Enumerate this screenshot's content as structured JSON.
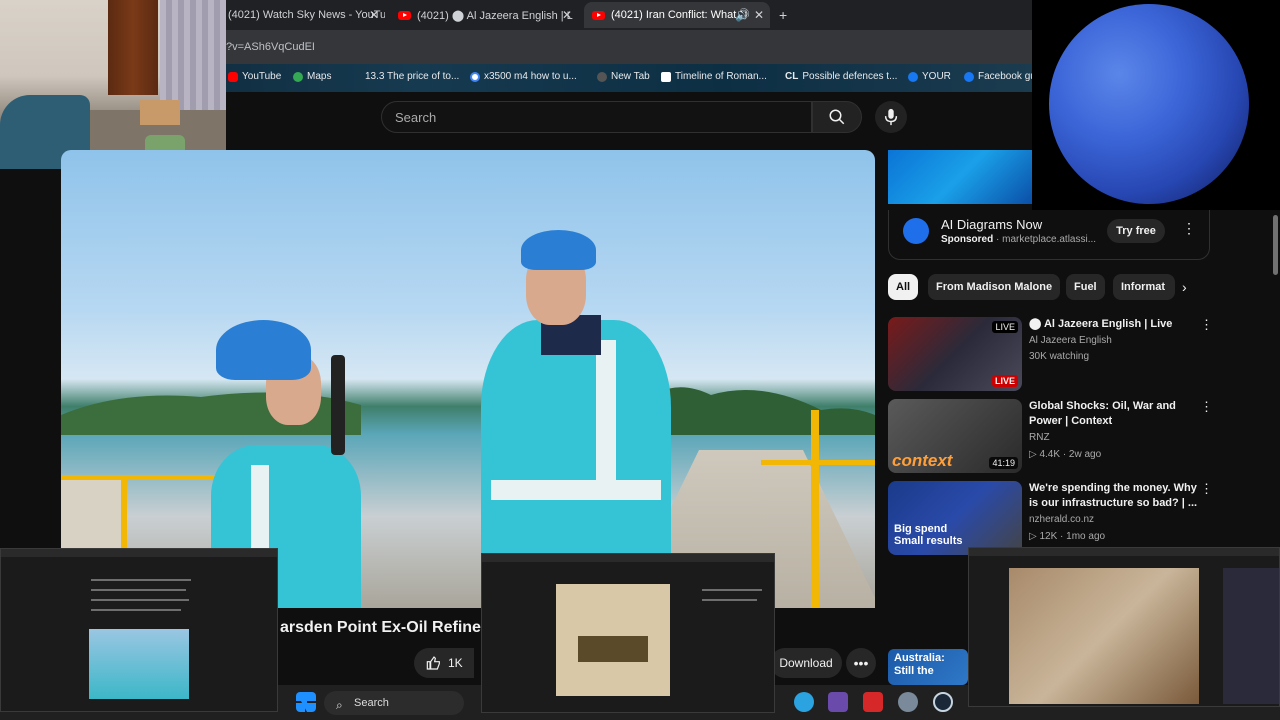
{
  "browser": {
    "tabs": [
      {
        "label": "(4021) Watch Sky News - YouTu",
        "active": false
      },
      {
        "label": "(4021) ⬤ Al Jazeera English | L",
        "active": false
      },
      {
        "label": "(4021) Iran Conflict: What N",
        "active": true
      }
    ],
    "address": "?v=ASh6VqCudEI",
    "bookmarks": [
      "YouTube",
      "Maps",
      "13.3 The price of to...",
      "x3500 m4 how to u...",
      "New Tab",
      "Timeline of Roman...",
      "Possible defences t...",
      "YOUR",
      "Facebook gu"
    ]
  },
  "youtube": {
    "search_placeholder": "Search",
    "video": {
      "title": "arsden Point Ex-Oil Refinery",
      "likes": "1K",
      "download_label": "Download"
    },
    "ad": {
      "title": "AI Diagrams Now",
      "sponsored": "Sponsored",
      "domain": "· marketplace.atlassi...",
      "cta": "Try free"
    },
    "chips": [
      "All",
      "From Madison Malone",
      "Fuel",
      "Informat"
    ],
    "recommendations": [
      {
        "title": "⬤ Al Jazeera English | Live",
        "channel": "Al Jazeera English",
        "meta": "30K watching",
        "badge": "LIVE",
        "verified": true
      },
      {
        "title": "Global Shocks: Oil, War and Power | Context",
        "channel": "RNZ",
        "meta": "▷ 4.4K · 2w ago",
        "badge": "41:19",
        "verified": false,
        "thumb_text": "context"
      },
      {
        "title": "We're spending the money. Why is our infrastructure so bad? | ...",
        "channel": "nzherald.co.nz",
        "meta": "▷ 12K · 1mo ago",
        "badge": "",
        "verified": true,
        "thumb_text": "Big spend Small results"
      },
      {
        "title": "",
        "channel": "",
        "meta": "",
        "badge": "",
        "thumb_text": "Australia: Still the"
      }
    ]
  },
  "taskbar": {
    "search_placeholder": "Search"
  },
  "colors": {
    "yt_red": "#ff0000",
    "bg": "#0f0f0f",
    "chip": "#272727",
    "live": "#cc0000"
  },
  "icons": [
    "search-icon",
    "mic-icon",
    "like-icon",
    "more-icon",
    "chevron-right-icon",
    "windows-start-icon",
    "telegram-icon",
    "settings-icon",
    "steam-icon"
  ]
}
